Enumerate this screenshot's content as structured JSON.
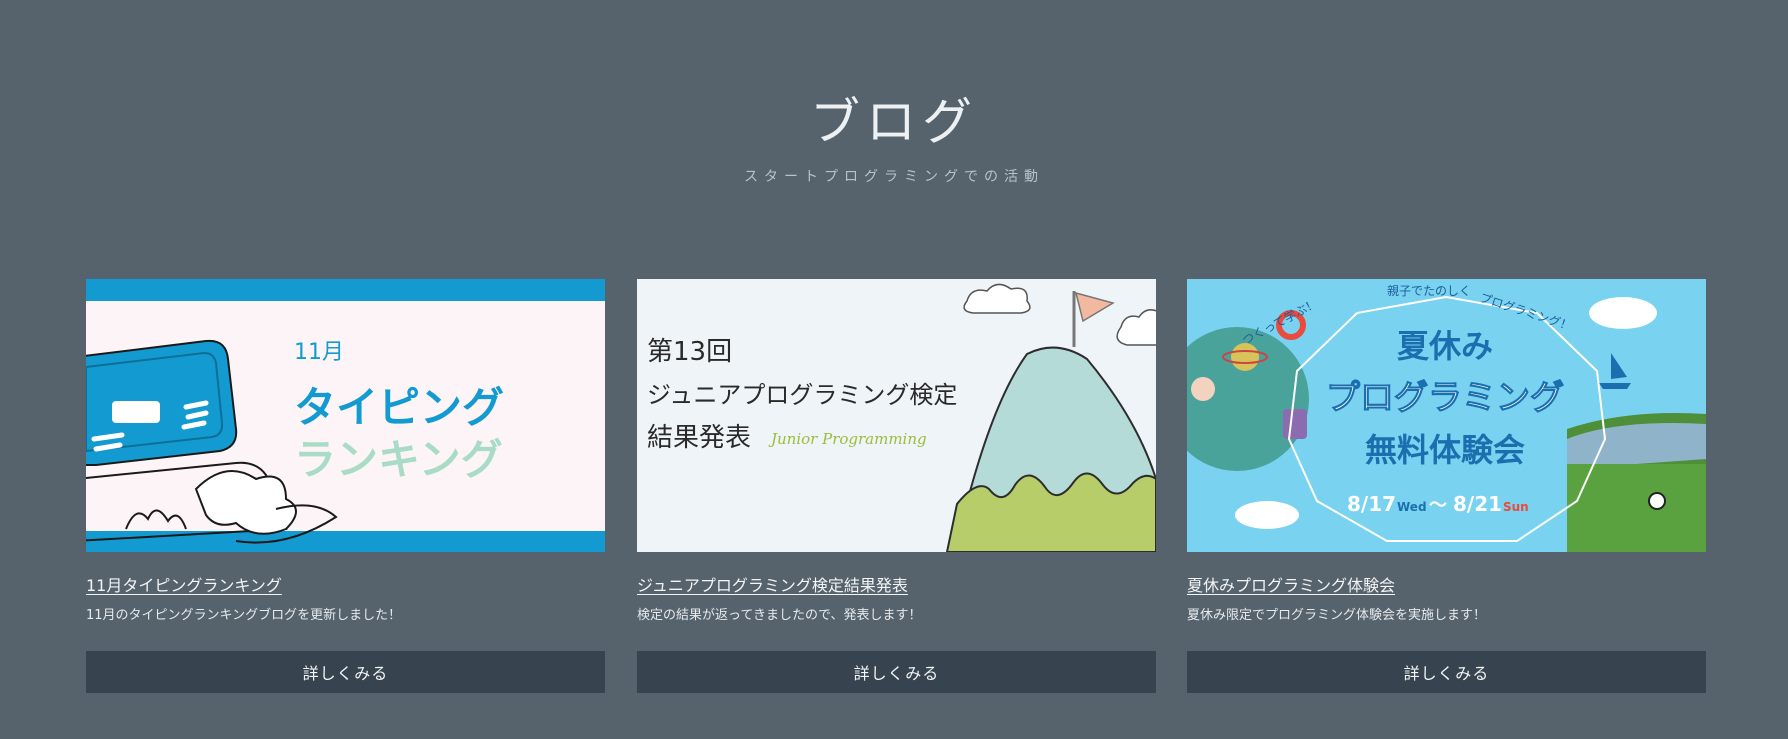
{
  "section": {
    "title": "ブログ",
    "subtitle": "スタートプログラミングでの活動"
  },
  "cards": [
    {
      "title": "11月タイピングランキング",
      "description": "11月のタイピングランキングブログを更新しました！",
      "button": "詳しくみる",
      "image": {
        "month": "11月",
        "line1": "タイピング",
        "line2": "ランキング"
      }
    },
    {
      "title": "ジュニアプログラミング検定結果発表",
      "description": "検定の結果が返ってきましたので、発表します！",
      "button": "詳しくみる",
      "image": {
        "line1": "第13回",
        "line2": "ジュニアプログラミング検定",
        "line3": "結果発表",
        "script": "Junior Programming"
      }
    },
    {
      "title": "夏休みプログラミング体験会",
      "description": "夏休み限定でプログラミング体験会を実施します！",
      "button": "詳しくみる",
      "image": {
        "tagline_left": "つくって学ぶ！",
        "tagline_mid": "親子でたのしく",
        "tagline_right": "プログラミング！",
        "line1": "夏休み",
        "line2": "プログラミング",
        "line3": "無料体験会",
        "date_start": "8/17",
        "day_start": "Wed",
        "tilde": "〜",
        "date_end": "8/21",
        "day_end": "Sun"
      }
    }
  ],
  "colors": {
    "background": "#56626c",
    "button": "#37434e",
    "typing_blue": "#139bd1",
    "typing_green": "#a9dcc6"
  }
}
